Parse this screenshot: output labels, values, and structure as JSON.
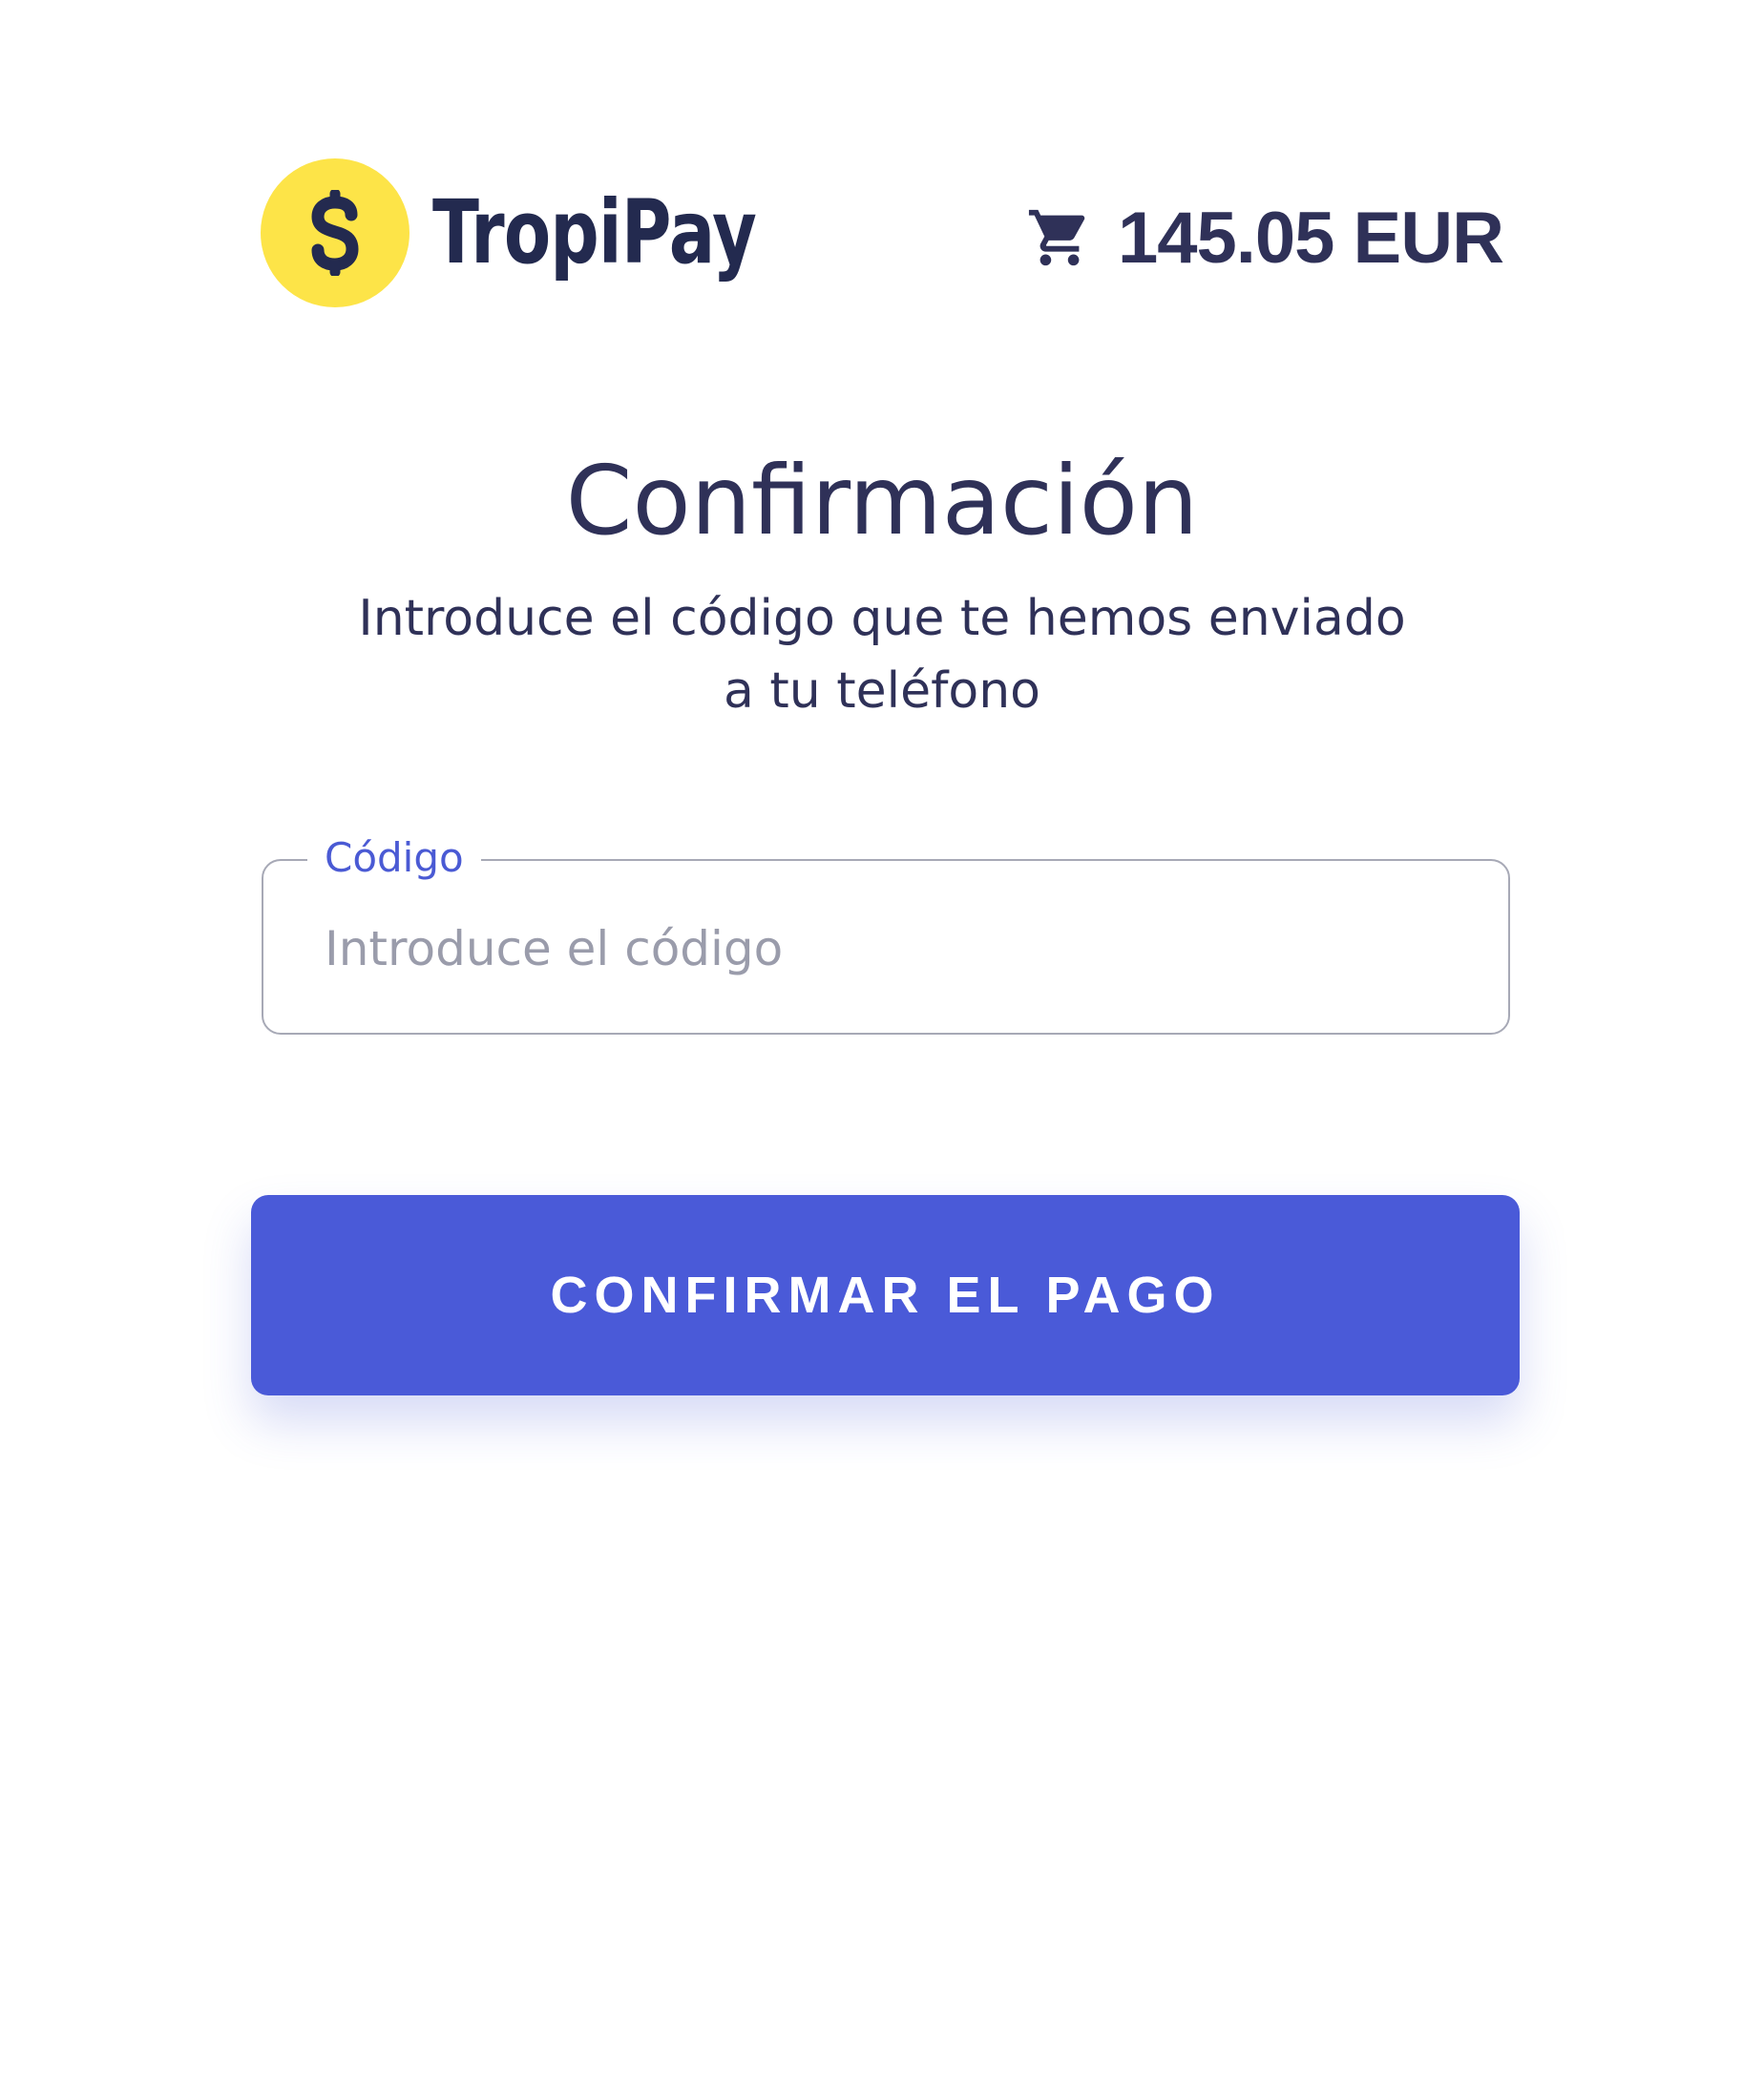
{
  "header": {
    "brand_name": "TropiPay",
    "logo_icon": "tropipay-dollar-logo-icon",
    "cart_icon": "shopping-cart-icon",
    "amount": "145.05 EUR"
  },
  "main": {
    "title": "Confirmación",
    "subtitle_line1": "Introduce el código que te hemos enviado",
    "subtitle_line2": "a tu teléfono"
  },
  "code_field": {
    "label": "Código",
    "placeholder": "Introduce el código",
    "value": ""
  },
  "confirm_button": {
    "label": "CONFIRMAR EL PAGO"
  },
  "colors": {
    "logo_yellow": "#fde448",
    "text_navy": "#2f3158",
    "brand_navy": "#232a4f",
    "primary_blue": "#4a5ad8",
    "label_blue": "#4a5ad4",
    "placeholder_gray": "#9a9cab",
    "border_gray": "#a7a9b6",
    "background": "#ffffff"
  }
}
